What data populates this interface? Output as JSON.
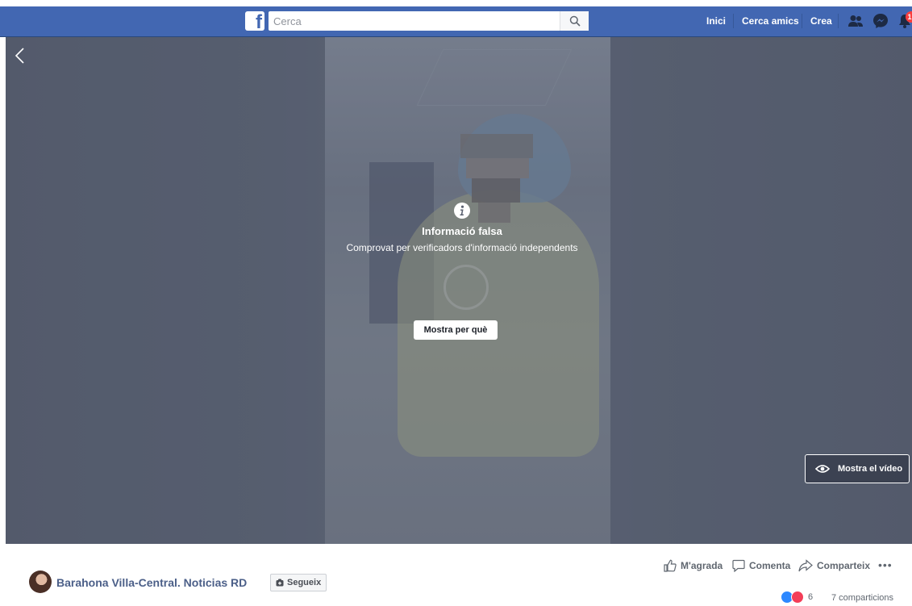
{
  "header": {
    "search_placeholder": "Cerca",
    "nav": {
      "home": "Inici",
      "find_friends": "Cerca amics",
      "create": "Crea"
    },
    "notification_count": "1",
    "colors": {
      "brand": "#4267b2",
      "badge": "#fa3e3e"
    }
  },
  "video": {
    "warning_title": "Informació falsa",
    "warning_subtitle": "Comprovat per verificadors d'informació independents",
    "why_button": "Mostra per què",
    "show_video_button": "Mostra el vídeo"
  },
  "post": {
    "page_name": "Barahona Villa-Central. Noticias RD",
    "follow_label": "Segueix",
    "actions": {
      "like": "M'agrada",
      "comment": "Comenta",
      "share": "Comparteix"
    },
    "reaction_count": "6",
    "shares_label": "7 comparticions"
  },
  "icons": [
    "facebook-logo-icon",
    "search-icon",
    "friends-icon",
    "messenger-icon",
    "bell-icon",
    "back-arrow-icon",
    "info-icon",
    "eye-icon",
    "follow-icon",
    "like-icon",
    "comment-icon",
    "share-icon",
    "more-icon",
    "like-reaction-icon",
    "love-reaction-icon"
  ]
}
